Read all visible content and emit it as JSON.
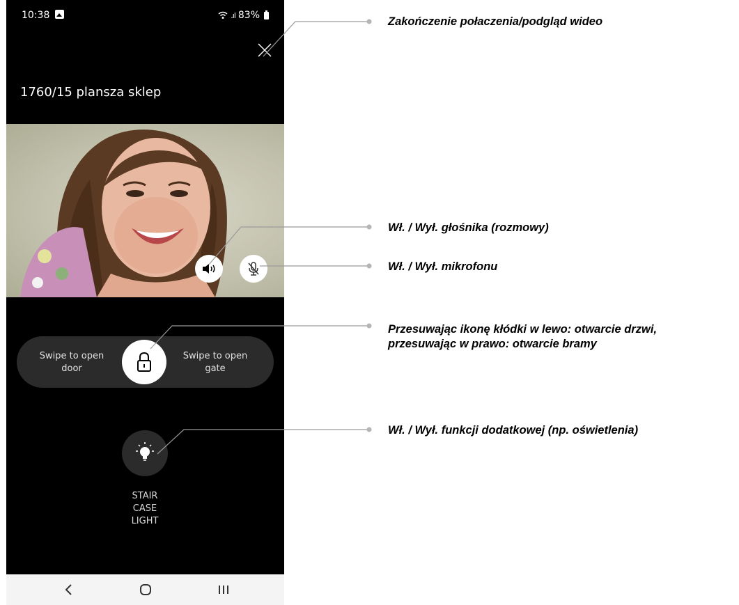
{
  "status_bar": {
    "time": "10:38",
    "signal": ".ıl",
    "battery": "83%"
  },
  "call": {
    "device_name": "1760/15 plansza sklep"
  },
  "slider": {
    "left_label": "Swipe to open\ndoor",
    "right_label": "Swipe to open\ngate"
  },
  "extra_function": {
    "label": "STAIR\nCASE\nLIGHT"
  },
  "annotations": {
    "close": "Zakończenie połaczenia/podgląd wideo",
    "speaker": "Wł. / Wył. głośnika (rozmowy)",
    "mic": "Wł. / Wył. mikrofonu",
    "lock_line1": "Przesuwając ikonę kłódki w lewo: otwarcie drzwi,",
    "lock_line2": "przesuwając w prawo: otwarcie bramy",
    "light": "Wł. / Wył. funkcji dodatkowej (np. oświetlenia)"
  },
  "colors": {
    "background": "#000000",
    "panel": "#2b2b2b",
    "button": "#ffffff",
    "callout_line": "#9a9a9a",
    "nav_bar": "#f4f4f4"
  },
  "icons": [
    "gallery-icon",
    "wifi-icon",
    "battery-icon",
    "close-icon",
    "speaker-icon",
    "mic-off-icon",
    "lock-icon",
    "lightbulb-icon",
    "back-icon",
    "home-icon",
    "recents-icon"
  ]
}
